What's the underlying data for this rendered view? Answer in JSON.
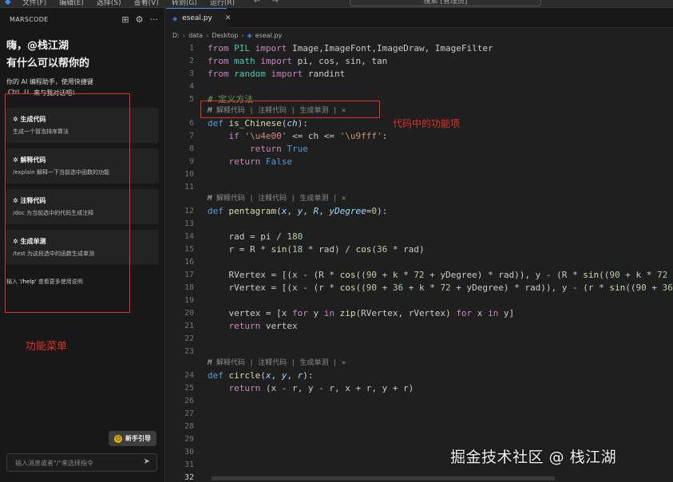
{
  "titlebar": {
    "menu": [
      "文件(F)",
      "编辑(E)",
      "选择(S)",
      "查看(V)",
      "转到(G)",
      "运行(R)"
    ],
    "search": "搜索 [管理员]"
  },
  "sidebar": {
    "title": "MARSCODE",
    "greeting_line1": "嗨，@栈江湖",
    "greeting_line2": "有什么可以帮你的",
    "desc_line1": "你的 AI 编程助手，使用快捷键",
    "desc_ctrl": "Ctrl",
    "desc_u": "U",
    "desc_tail": "来与我对话吧！",
    "cards": [
      {
        "title": "生成代码",
        "subtitle": "生成一个冒泡排序算法"
      },
      {
        "title": "解释代码",
        "subtitle": "/explain 解释一下当前选中函数的功能"
      },
      {
        "title": "注释代码",
        "subtitle": "/doc 为当前选中的代码生成注释"
      },
      {
        "title": "生成单测",
        "subtitle": "/test 为这段选中的函数生成单测"
      }
    ],
    "help_prefix": "输入",
    "help_cmd": "'/help'",
    "help_suffix": "查看更多使用说明",
    "menu_annotation": "功能菜单",
    "guide_button": "新手引导",
    "input_placeholder": "输入消息或者\"/\"来选择指令"
  },
  "editor": {
    "tab_name": "eseal.py",
    "breadcrumb": [
      "D:",
      "data",
      "Desktop",
      "eseal.py"
    ],
    "code_lens": {
      "explain": "解释代码",
      "comment": "注释代码",
      "test": "生成单测"
    },
    "code_annotation": "代码中的功能项",
    "line_numbers": [
      "1",
      "2",
      "3",
      "4",
      "5",
      "6",
      "7",
      "8",
      "9",
      "10",
      "11",
      "12",
      "13",
      "14",
      "15",
      "16",
      "17",
      "18",
      "19",
      "20",
      "21",
      "22",
      "23",
      "24",
      "25",
      "26",
      "27",
      "28",
      "29",
      "30",
      "31",
      "32"
    ]
  },
  "watermark": "掘金技术社区 @ 栈江湖"
}
